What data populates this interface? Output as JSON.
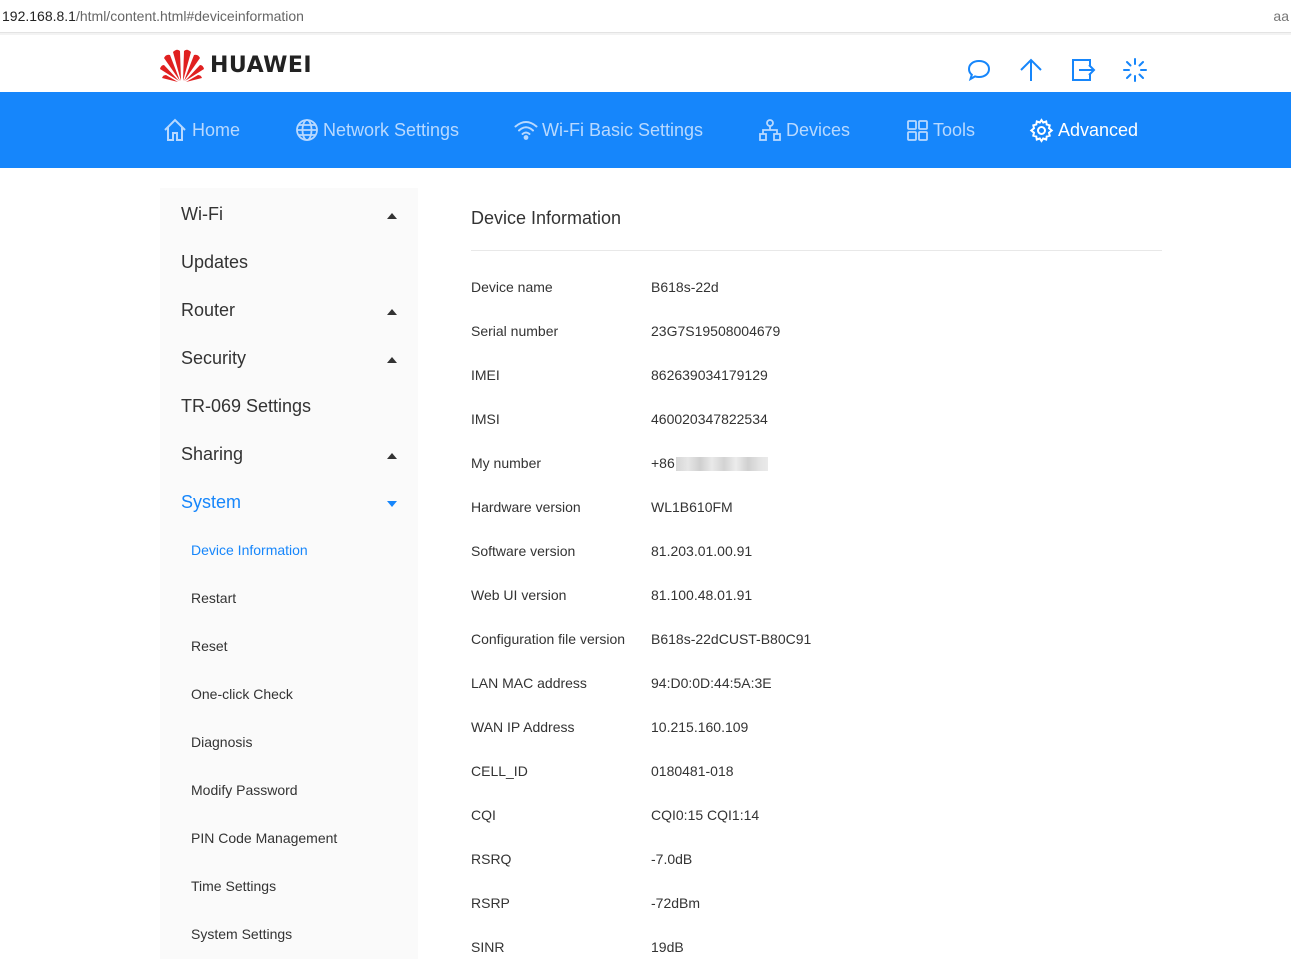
{
  "browser": {
    "url_host": "192.168.8.1",
    "url_path": "/html/content.html#deviceinformation",
    "corner_text": "aa"
  },
  "brand": {
    "name": "HUAWEI",
    "color": "#e02020"
  },
  "header_icons": [
    "message-icon",
    "upload-icon",
    "logout-icon",
    "loading-icon"
  ],
  "nav": {
    "background": "#1686fb",
    "items": [
      {
        "label": "Home",
        "icon": "home-icon"
      },
      {
        "label": "Network Settings",
        "icon": "globe-icon"
      },
      {
        "label": "Wi-Fi Basic Settings",
        "icon": "wifi-icon"
      },
      {
        "label": "Devices",
        "icon": "devices-icon"
      },
      {
        "label": "Tools",
        "icon": "tools-icon"
      },
      {
        "label": "Advanced",
        "icon": "gear-icon",
        "active": true
      }
    ]
  },
  "sidebar": {
    "items": [
      {
        "label": "Wi-Fi",
        "expanded": false
      },
      {
        "label": "Updates"
      },
      {
        "label": "Router",
        "expanded": false
      },
      {
        "label": "Security",
        "expanded": false
      },
      {
        "label": "TR-069 Settings"
      },
      {
        "label": "Sharing",
        "expanded": false
      },
      {
        "label": "System",
        "expanded": true,
        "active": true
      }
    ],
    "sub_items": [
      {
        "label": "Device Information",
        "active": true
      },
      {
        "label": "Restart"
      },
      {
        "label": "Reset"
      },
      {
        "label": "One-click Check"
      },
      {
        "label": "Diagnosis"
      },
      {
        "label": "Modify Password"
      },
      {
        "label": "PIN Code Management"
      },
      {
        "label": "Time Settings"
      },
      {
        "label": "System Settings"
      }
    ]
  },
  "main": {
    "title": "Device Information",
    "rows": [
      {
        "label": "Device name",
        "value": "B618s-22d"
      },
      {
        "label": "Serial number",
        "value": "23G7S19508004679"
      },
      {
        "label": "IMEI",
        "value": "862639034179129"
      },
      {
        "label": "IMSI",
        "value": "460020347822534"
      },
      {
        "label": "My number",
        "value": "+86",
        "redacted": true
      },
      {
        "label": "Hardware version",
        "value": "WL1B610FM"
      },
      {
        "label": "Software version",
        "value": "81.203.01.00.91"
      },
      {
        "label": "Web UI version",
        "value": "81.100.48.01.91"
      },
      {
        "label": "Configuration file version",
        "value": "B618s-22dCUST-B80C91"
      },
      {
        "label": "LAN MAC address",
        "value": "94:D0:0D:44:5A:3E"
      },
      {
        "label": "WAN IP Address",
        "value": "10.215.160.109"
      },
      {
        "label": "CELL_ID",
        "value": "0180481-018"
      },
      {
        "label": "CQI",
        "value": "CQI0:15 CQI1:14"
      },
      {
        "label": "RSRQ",
        "value": "-7.0dB"
      },
      {
        "label": "RSRP",
        "value": "-72dBm"
      },
      {
        "label": "SINR",
        "value": "19dB"
      }
    ]
  }
}
